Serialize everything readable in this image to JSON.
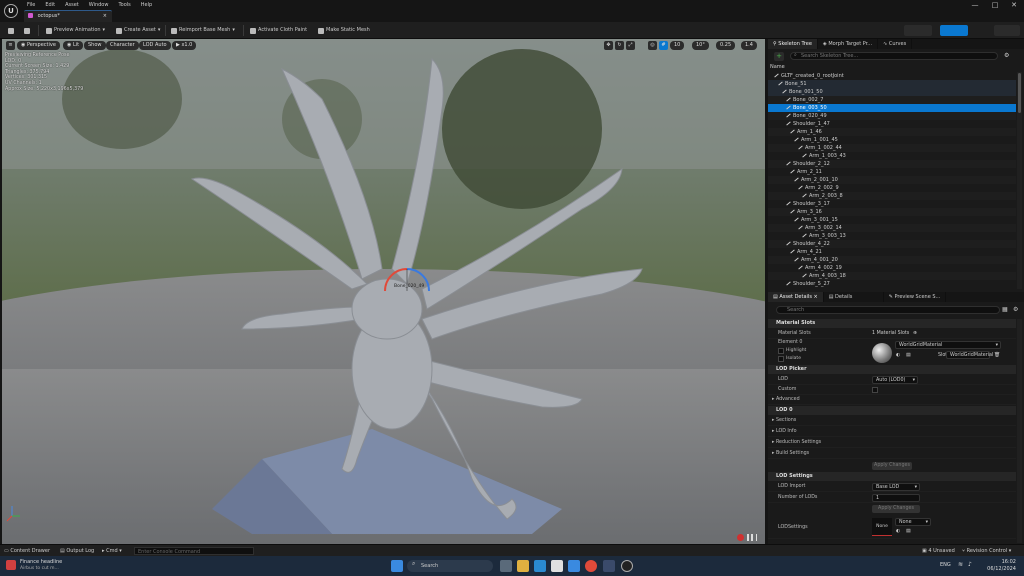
{
  "window": {
    "menu": [
      "File",
      "Edit",
      "Asset",
      "Window",
      "Tools",
      "Help"
    ],
    "tab_title": "octopus*",
    "tab_close": "×",
    "controls": [
      "—",
      "□",
      "✕"
    ]
  },
  "toolbar": {
    "preview_animation": "Preview Animation",
    "create_asset": "Create Asset",
    "reimport": "Reimport Base Mesh",
    "activate_cloth": "Activate Cloth Paint",
    "make_static": "Make Static Mesh"
  },
  "viewport": {
    "perspective": "Perspective",
    "lit": "Lit",
    "show": "Show",
    "character": "Character",
    "lod": "LOD Auto",
    "speed": "x1.0",
    "right_icons": [
      "10",
      "10°",
      "0.25",
      "1.4"
    ],
    "stats": [
      "Previewing Reference Pose",
      "LOD: 0",
      "Current Screen Size: 1.429",
      "Triangles: 375,794",
      "Vertices: 301,315",
      "UV Channels: 1",
      "Approx Size: 5,220x3,196x5,379"
    ],
    "bone_label": "Bone_020_49"
  },
  "skeleton": {
    "tabs": [
      "Skeleton Tree",
      "Morph Target Pr...",
      "Curves"
    ],
    "search_placeholder": "Search Skeleton Tree...",
    "column": "Name",
    "rows": [
      {
        "label": "GLTF_created_0_rootJoint",
        "indent": 0
      },
      {
        "label": "Bone_51",
        "indent": 1
      },
      {
        "label": "Bone_001_50",
        "indent": 2
      },
      {
        "label": "Bone_002_7",
        "indent": 3
      },
      {
        "label": "Bone_003_50",
        "indent": 3
      },
      {
        "label": "Bone_020_49",
        "indent": 3
      },
      {
        "label": "Shoulder_1_47",
        "indent": 3
      },
      {
        "label": "Arm_1_46",
        "indent": 4
      },
      {
        "label": "Arm_1_001_45",
        "indent": 5
      },
      {
        "label": "Arm_1_002_44",
        "indent": 6
      },
      {
        "label": "Arm_1_003_43",
        "indent": 7
      },
      {
        "label": "Shoulder_2_12",
        "indent": 3
      },
      {
        "label": "Arm_2_11",
        "indent": 4
      },
      {
        "label": "Arm_2_001_10",
        "indent": 5
      },
      {
        "label": "Arm_2_002_9",
        "indent": 6
      },
      {
        "label": "Arm_2_003_8",
        "indent": 7
      },
      {
        "label": "Shoulder_3_17",
        "indent": 3
      },
      {
        "label": "Arm_3_16",
        "indent": 4
      },
      {
        "label": "Arm_3_001_15",
        "indent": 5
      },
      {
        "label": "Arm_3_002_14",
        "indent": 6
      },
      {
        "label": "Arm_3_003_13",
        "indent": 7
      },
      {
        "label": "Shoulder_4_22",
        "indent": 3
      },
      {
        "label": "Arm_4_21",
        "indent": 4
      },
      {
        "label": "Arm_4_001_20",
        "indent": 5
      },
      {
        "label": "Arm_4_002_19",
        "indent": 6
      },
      {
        "label": "Arm_4_003_18",
        "indent": 7
      },
      {
        "label": "Shoulder_5_27",
        "indent": 3
      }
    ]
  },
  "details": {
    "tabs": [
      "Asset Details",
      "Details",
      "Preview Scene S..."
    ],
    "search_placeholder": "Search",
    "material_slots_header": "Material Slots",
    "material_slots_label": "Material Slots",
    "material_slots_value": "1 Material Slots",
    "element": "Element 0",
    "highlight": "Highlight",
    "isolate": "Isolate",
    "material_name": "WorldGridMaterial",
    "slot_label": "Slot",
    "slot_value": "WorldGridMaterial",
    "lod_picker_header": "LOD Picker",
    "lod_label": "LOD",
    "lod_value": "Auto (LOD0)",
    "custom_label": "Custom",
    "advanced": "Advanced",
    "lod0_header": "LOD 0",
    "sections": "Sections",
    "lod_info": "LOD Info",
    "reduction": "Reduction Settings",
    "build": "Build Settings",
    "apply_changes": "Apply Changes",
    "lod_settings_header": "LOD Settings",
    "lod_import_label": "LOD Import",
    "lod_import_value": "Base LOD",
    "num_lods_label": "Number of LODs",
    "num_lods_value": "1",
    "apply_changes2": "Apply Changes",
    "lodsettings_label": "LODSettings",
    "lodsettings_thumb": "None",
    "lodsettings_value": "None"
  },
  "statusbar": {
    "content_drawer": "Content Drawer",
    "output_log": "Output Log",
    "cmd": "Cmd",
    "console_placeholder": "Enter Console Command",
    "unsaved": "4 Unsaved",
    "revision": "Revision Control"
  },
  "taskbar": {
    "news_title": "Finance headline",
    "news_sub": "Airbus to cut m...",
    "search": "Search",
    "lang": "ENG",
    "time": "16:02",
    "date": "06/12/2024"
  }
}
